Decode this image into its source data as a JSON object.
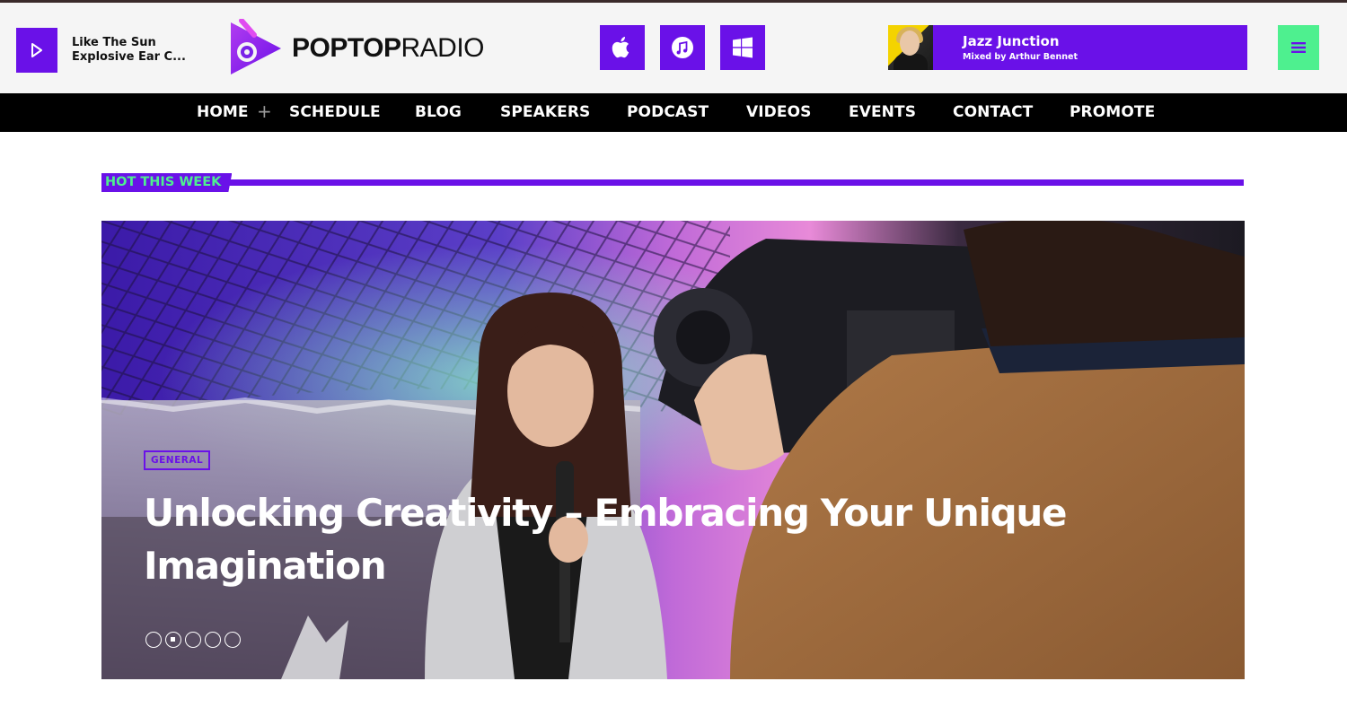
{
  "player": {
    "track_title": "Like The Sun",
    "track_artist": "Explosive Ear C..."
  },
  "logo": {
    "word_bold": "POPTOP",
    "word_light": "RADIO"
  },
  "store_icons": [
    "apple-icon",
    "itunes-music-icon",
    "windows-icon"
  ],
  "promo": {
    "title": "Jazz Junction",
    "subtitle": "Mixed by Arthur Bennet"
  },
  "nav": {
    "items": [
      "HOME",
      "SCHEDULE",
      "BLOG",
      "SPEAKERS",
      "PODCAST",
      "VIDEOS",
      "EVENTS",
      "CONTACT",
      "PROMOTE"
    ],
    "plus": "+"
  },
  "section": {
    "label": "HOT THIS WEEK"
  },
  "hero": {
    "category": "GENERAL",
    "title": "Unlocking Creativity – Embracing Your Unique Imagination",
    "slides": 5,
    "active_slide": 2
  },
  "colors": {
    "brand_purple": "#6a11e8",
    "accent_green": "#4ef08f",
    "nav_background": "#000000",
    "header_background": "#f5f5f5"
  }
}
